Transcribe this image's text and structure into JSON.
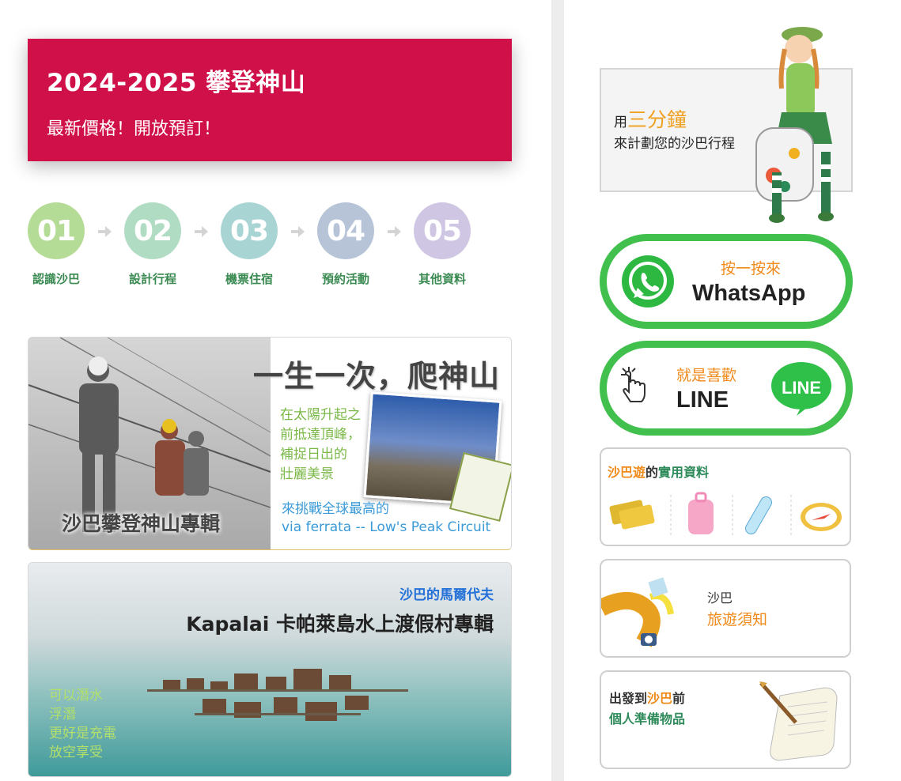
{
  "promo": {
    "title": "2024-2025 攀登神山",
    "subtitle": "最新價格！開放預訂！"
  },
  "steps": [
    {
      "num": "01",
      "label": "認識沙巴",
      "color": "#b5dc96"
    },
    {
      "num": "02",
      "label": "設計行程",
      "color": "#b0dcc4"
    },
    {
      "num": "03",
      "label": "機票住宿",
      "color": "#a9d4d4"
    },
    {
      "num": "04",
      "label": "預約活動",
      "color": "#b7c4d8"
    },
    {
      "num": "05",
      "label": "其他資料",
      "color": "#cfc6e4"
    }
  ],
  "banner_kinabalu": {
    "title": "一生一次，爬神山",
    "lines": [
      "在太陽升起之",
      "前抵達頂峰，",
      "補捉日出的",
      "壯麗美景"
    ],
    "challenge": [
      "來挑戰全球最高的",
      "via ferrata -- Low's Peak Circuit"
    ],
    "caption": "沙巴攀登神山專輯"
  },
  "banner_kapalai": {
    "tag": "沙巴的馬爾代夫",
    "title": "Kapalai 卡帕萊島水上渡假村專輯",
    "lines": [
      "可以潛水",
      "浮潛",
      "更好是充電",
      "放空享受"
    ]
  },
  "sidebar": {
    "plan": {
      "prefix": "用",
      "highlight": "三分鐘",
      "line2": "來計劃您的沙巴行程"
    },
    "whatsapp": {
      "top": "按一按來",
      "big": "WhatsApp"
    },
    "line": {
      "top": "就是喜歡",
      "big": "LINE",
      "logo": "LINE"
    },
    "card_info": {
      "part1": "沙巴遊",
      "part2": "的",
      "part3": "實用資料"
    },
    "card_notice": {
      "line1": "沙巴",
      "line2": "旅遊須知"
    },
    "card_prep": {
      "line1a": "出發到",
      "line1b": "沙巴",
      "line1c": "前",
      "line2": "個人準備物品"
    }
  },
  "colors": {
    "promo_bg": "#d01048",
    "accent_green": "#42c04e",
    "accent_orange": "#f08a1a"
  }
}
